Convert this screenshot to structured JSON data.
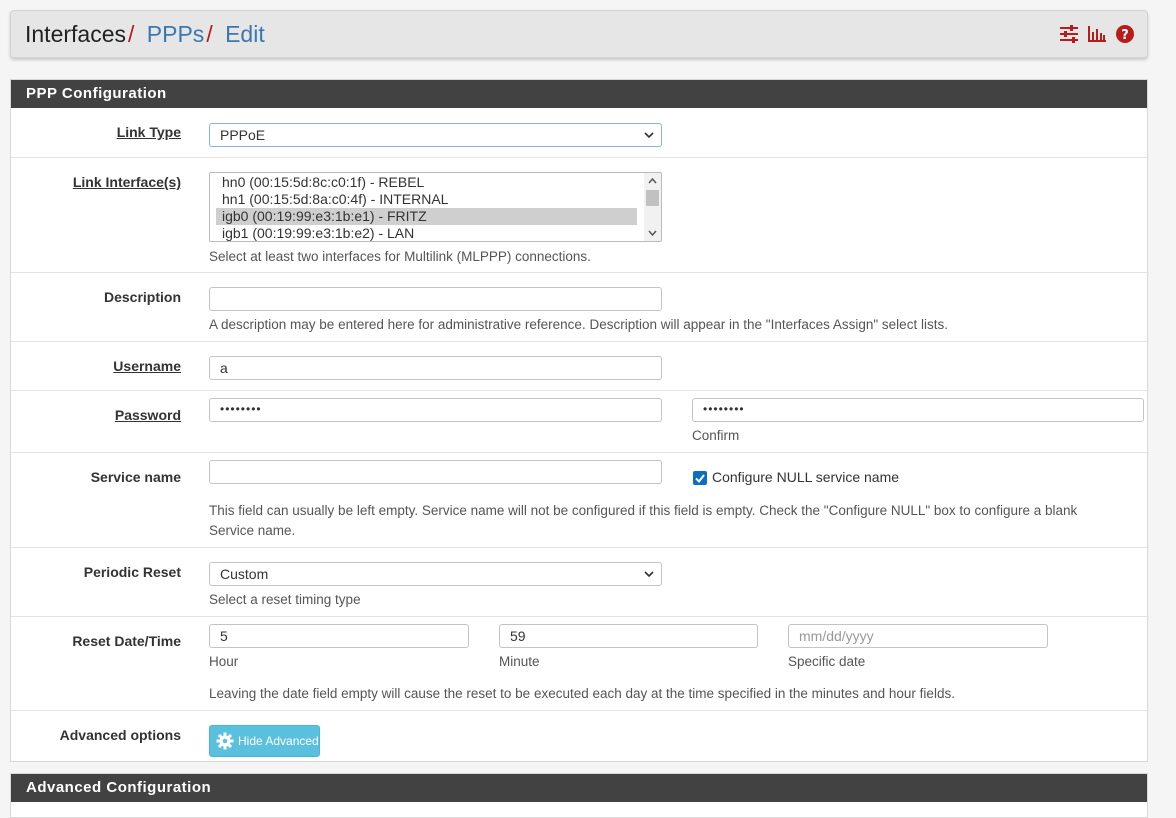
{
  "breadcrumb": {
    "root": "Interfaces",
    "sep": "/",
    "link1": "PPPs",
    "link2": "Edit"
  },
  "header_icons": [
    "sliders-icon",
    "chart-icon",
    "help-icon"
  ],
  "colors": {
    "accent": "#b71c1c",
    "panel_head": "#424242",
    "info_button": "#5bc0de",
    "link": "#3c78b0"
  },
  "ppp_panel": {
    "title": "PPP Configuration",
    "link_type": {
      "label": "Link Type",
      "value": "PPPoE"
    },
    "link_interfaces": {
      "label": "Link Interface(s)",
      "items": [
        "hn0 (00:15:5d:8c:c0:1f) - REBEL",
        "hn1 (00:15:5d:8a:c0:4f) - INTERNAL",
        "igb0 (00:19:99:e3:1b:e1) - FRITZ",
        "igb1 (00:19:99:e3:1b:e2) - LAN"
      ],
      "selected": "igb0 (00:19:99:e3:1b:e1) - FRITZ",
      "help": "Select at least two interfaces for Multilink (MLPPP) connections."
    },
    "description": {
      "label": "Description",
      "value": "",
      "help": "A description may be entered here for administrative reference. Description will appear in the \"Interfaces Assign\" select lists."
    },
    "username": {
      "label": "Username",
      "value": "a"
    },
    "password": {
      "label": "Password",
      "value": "••••••••",
      "confirm_value": "••••••••",
      "confirm_help": "Confirm"
    },
    "service_name": {
      "label": "Service name",
      "value": "",
      "null_checkbox_label": "Configure NULL service name",
      "null_checked": true,
      "help_line1": "This field can usually be left empty. Service name will not be configured if this field is empty. Check the \"Configure NULL\" box to configure a blank",
      "help_line2": "Service name."
    },
    "periodic_reset": {
      "label": "Periodic Reset",
      "value": "Custom",
      "help": "Select a reset timing type"
    },
    "reset_datetime": {
      "label": "Reset Date/Time",
      "hour": "5",
      "hour_help": "Hour",
      "minute": "59",
      "minute_help": "Minute",
      "date_placeholder": "mm/dd/yyyy",
      "date_help": "Specific date",
      "help": "Leaving the date field empty will cause the reset to be executed each day at the time specified in the minutes and hour fields."
    },
    "advanced": {
      "label": "Advanced options",
      "button": "Hide Advanced"
    }
  },
  "advanced_panel": {
    "title": "Advanced Configuration"
  }
}
